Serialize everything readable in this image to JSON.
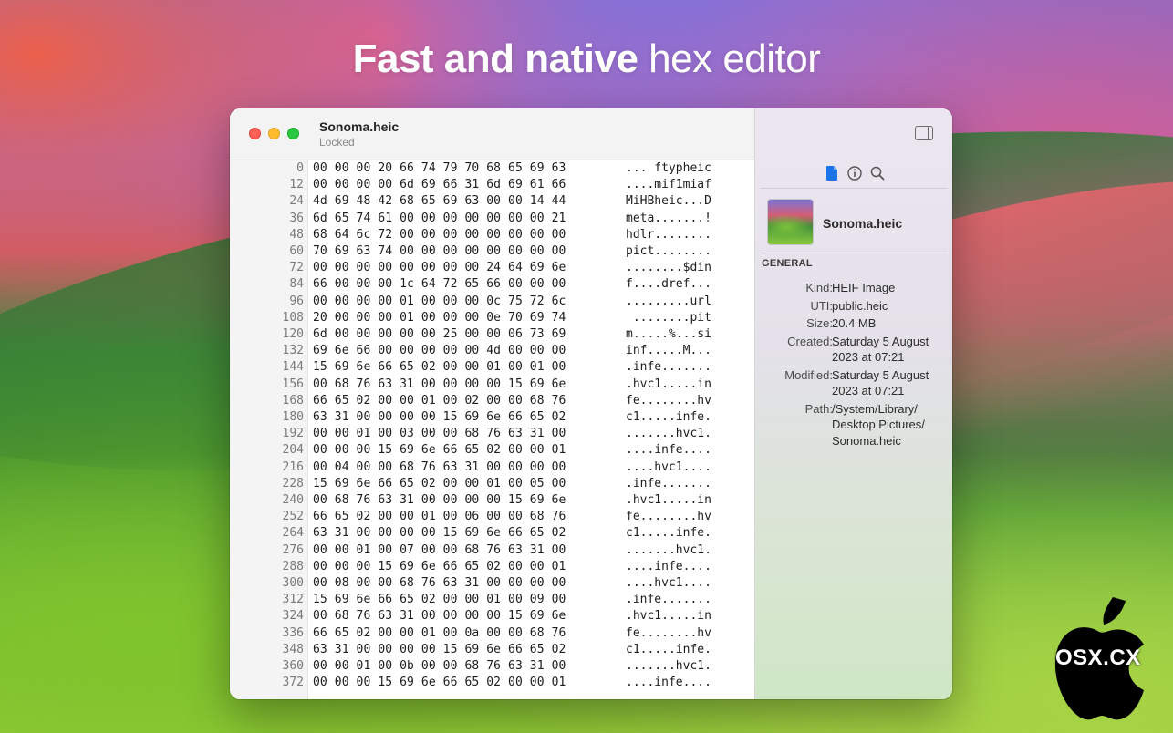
{
  "hero": {
    "title_bold": "Fast and native",
    "title_light": " hex editor"
  },
  "window": {
    "document_title": "Sonoma.heic",
    "document_subtitle": "Locked"
  },
  "hex_rows": [
    {
      "offset": "0",
      "bytes": "00 00 00 20 66 74 79 70 68 65 69 63",
      "ascii": "... ftypheic"
    },
    {
      "offset": "12",
      "bytes": "00 00 00 00 6d 69 66 31 6d 69 61 66",
      "ascii": "....mif1miaf"
    },
    {
      "offset": "24",
      "bytes": "4d 69 48 42 68 65 69 63 00 00 14 44",
      "ascii": "MiHBheic...D"
    },
    {
      "offset": "36",
      "bytes": "6d 65 74 61 00 00 00 00 00 00 00 21",
      "ascii": "meta.......!"
    },
    {
      "offset": "48",
      "bytes": "68 64 6c 72 00 00 00 00 00 00 00 00",
      "ascii": "hdlr........"
    },
    {
      "offset": "60",
      "bytes": "70 69 63 74 00 00 00 00 00 00 00 00",
      "ascii": "pict........"
    },
    {
      "offset": "72",
      "bytes": "00 00 00 00 00 00 00 00 24 64 69 6e",
      "ascii": "........$din"
    },
    {
      "offset": "84",
      "bytes": "66 00 00 00 1c 64 72 65 66 00 00 00",
      "ascii": "f....dref..."
    },
    {
      "offset": "96",
      "bytes": "00 00 00 00 01 00 00 00 0c 75 72 6c",
      "ascii": ".........url"
    },
    {
      "offset": "108",
      "bytes": "20 00 00 00 01 00 00 00 0e 70 69 74",
      "ascii": " ........pit"
    },
    {
      "offset": "120",
      "bytes": "6d 00 00 00 00 00 25 00 00 06 73 69",
      "ascii": "m.....%...si"
    },
    {
      "offset": "132",
      "bytes": "69 6e 66 00 00 00 00 00 4d 00 00 00",
      "ascii": "inf.....M..."
    },
    {
      "offset": "144",
      "bytes": "15 69 6e 66 65 02 00 00 01 00 01 00",
      "ascii": ".infe......."
    },
    {
      "offset": "156",
      "bytes": "00 68 76 63 31 00 00 00 00 15 69 6e",
      "ascii": ".hvc1.....in"
    },
    {
      "offset": "168",
      "bytes": "66 65 02 00 00 01 00 02 00 00 68 76",
      "ascii": "fe........hv"
    },
    {
      "offset": "180",
      "bytes": "63 31 00 00 00 00 15 69 6e 66 65 02",
      "ascii": "c1.....infe."
    },
    {
      "offset": "192",
      "bytes": "00 00 01 00 03 00 00 68 76 63 31 00",
      "ascii": ".......hvc1."
    },
    {
      "offset": "204",
      "bytes": "00 00 00 15 69 6e 66 65 02 00 00 01",
      "ascii": "....infe...."
    },
    {
      "offset": "216",
      "bytes": "00 04 00 00 68 76 63 31 00 00 00 00",
      "ascii": "....hvc1...."
    },
    {
      "offset": "228",
      "bytes": "15 69 6e 66 65 02 00 00 01 00 05 00",
      "ascii": ".infe......."
    },
    {
      "offset": "240",
      "bytes": "00 68 76 63 31 00 00 00 00 15 69 6e",
      "ascii": ".hvc1.....in"
    },
    {
      "offset": "252",
      "bytes": "66 65 02 00 00 01 00 06 00 00 68 76",
      "ascii": "fe........hv"
    },
    {
      "offset": "264",
      "bytes": "63 31 00 00 00 00 15 69 6e 66 65 02",
      "ascii": "c1.....infe."
    },
    {
      "offset": "276",
      "bytes": "00 00 01 00 07 00 00 68 76 63 31 00",
      "ascii": ".......hvc1."
    },
    {
      "offset": "288",
      "bytes": "00 00 00 15 69 6e 66 65 02 00 00 01",
      "ascii": "....infe...."
    },
    {
      "offset": "300",
      "bytes": "00 08 00 00 68 76 63 31 00 00 00 00",
      "ascii": "....hvc1...."
    },
    {
      "offset": "312",
      "bytes": "15 69 6e 66 65 02 00 00 01 00 09 00",
      "ascii": ".infe......."
    },
    {
      "offset": "324",
      "bytes": "00 68 76 63 31 00 00 00 00 15 69 6e",
      "ascii": ".hvc1.....in"
    },
    {
      "offset": "336",
      "bytes": "66 65 02 00 00 01 00 0a 00 00 68 76",
      "ascii": "fe........hv"
    },
    {
      "offset": "348",
      "bytes": "63 31 00 00 00 00 15 69 6e 66 65 02",
      "ascii": "c1.....infe."
    },
    {
      "offset": "360",
      "bytes": "00 00 01 00 0b 00 00 68 76 63 31 00",
      "ascii": ".......hvc1."
    },
    {
      "offset": "372",
      "bytes": "00 00 00 15 69 6e 66 65 02 00 00 01",
      "ascii": "....infe...."
    }
  ],
  "sidebar": {
    "tabs": [
      {
        "icon": "document-icon",
        "color": "#1a73e8"
      },
      {
        "icon": "info-icon",
        "color": "#555555"
      },
      {
        "icon": "search-icon",
        "color": "#555555"
      }
    ],
    "file_name": "Sonoma.heic",
    "section_heading": "GENERAL",
    "properties": [
      {
        "label": "Kind:",
        "value": "HEIF Image"
      },
      {
        "label": "UTI:",
        "value": "public.heic"
      },
      {
        "label": "Size:",
        "value": "20.4 MB"
      },
      {
        "label": "Created:",
        "value": "Saturday 5 August 2023 at 07:21"
      },
      {
        "label": "Modified:",
        "value": "Saturday 5 August 2023 at 07:21"
      },
      {
        "label": "Path:",
        "value": "/System/Library/ Desktop Pictures/ Sonoma.heic"
      }
    ]
  },
  "watermark": {
    "text": "OSX.CX"
  }
}
